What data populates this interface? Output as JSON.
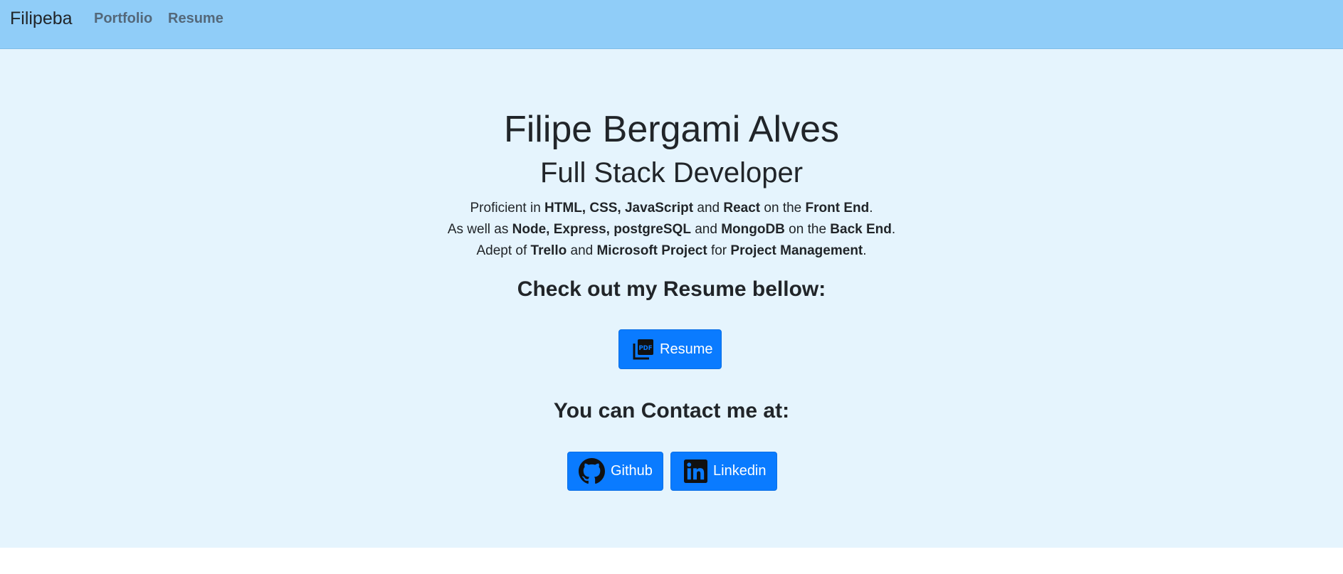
{
  "navbar": {
    "brand": "Filipeba",
    "links": [
      "Portfolio",
      "Resume"
    ]
  },
  "hero": {
    "name": "Filipe Bergami Alves",
    "role": "Full Stack Developer",
    "skills": [
      {
        "parts": [
          {
            "text": "Proficient in ",
            "bold": false
          },
          {
            "text": "HTML, CSS, JavaScript",
            "bold": true
          },
          {
            "text": " and ",
            "bold": false
          },
          {
            "text": "React",
            "bold": true
          },
          {
            "text": " on the ",
            "bold": false
          },
          {
            "text": "Front End",
            "bold": true
          },
          {
            "text": ".",
            "bold": false
          }
        ]
      },
      {
        "parts": [
          {
            "text": "As well as ",
            "bold": false
          },
          {
            "text": "Node, Express, postgreSQL",
            "bold": true
          },
          {
            "text": " and ",
            "bold": false
          },
          {
            "text": "MongoDB",
            "bold": true
          },
          {
            "text": " on the ",
            "bold": false
          },
          {
            "text": "Back End",
            "bold": true
          },
          {
            "text": ".",
            "bold": false
          }
        ]
      },
      {
        "parts": [
          {
            "text": "Adept of ",
            "bold": false
          },
          {
            "text": "Trello",
            "bold": true
          },
          {
            "text": " and ",
            "bold": false
          },
          {
            "text": "Microsoft Project",
            "bold": true
          },
          {
            "text": " for ",
            "bold": false
          },
          {
            "text": "Project Management",
            "bold": true
          },
          {
            "text": ".",
            "bold": false
          }
        ]
      }
    ],
    "resume_heading": "Check out my Resume bellow:",
    "resume_button": {
      "label": "Resume",
      "icon": "pdf-icon"
    },
    "contact_heading": "You can Contact me at:",
    "contact_buttons": [
      {
        "label": "Github",
        "icon": "github-icon"
      },
      {
        "label": "Linkedin",
        "icon": "linkedin-icon"
      }
    ]
  },
  "colors": {
    "navbar_bg": "#90cdf8",
    "hero_bg": "#e5f4fd",
    "button_bg": "#0a7bff",
    "text": "#212529",
    "nav_link": "#54687a"
  }
}
